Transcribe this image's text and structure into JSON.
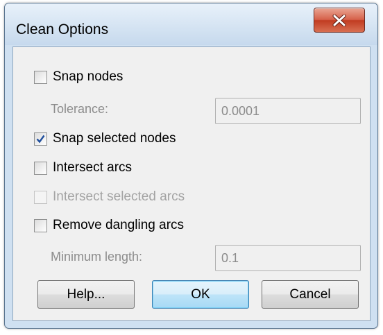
{
  "window": {
    "title": "Clean Options"
  },
  "options": {
    "snap_nodes": {
      "label": "Snap nodes",
      "checked": false
    },
    "tolerance": {
      "label": "Tolerance:",
      "value": "0.0001"
    },
    "snap_selected_nodes": {
      "label": "Snap selected nodes",
      "checked": true
    },
    "intersect_arcs": {
      "label": "Intersect arcs",
      "checked": false
    },
    "intersect_selected_arcs": {
      "label": "Intersect selected arcs",
      "checked": false,
      "enabled": false
    },
    "remove_dangling_arcs": {
      "label": "Remove dangling arcs",
      "checked": false
    },
    "minimum_length": {
      "label": "Minimum length:",
      "value": "0.1"
    }
  },
  "buttons": {
    "help": "Help...",
    "ok": "OK",
    "cancel": "Cancel"
  },
  "colors": {
    "accent_check": "#1f4e9c",
    "close_red": "#c9452b"
  }
}
